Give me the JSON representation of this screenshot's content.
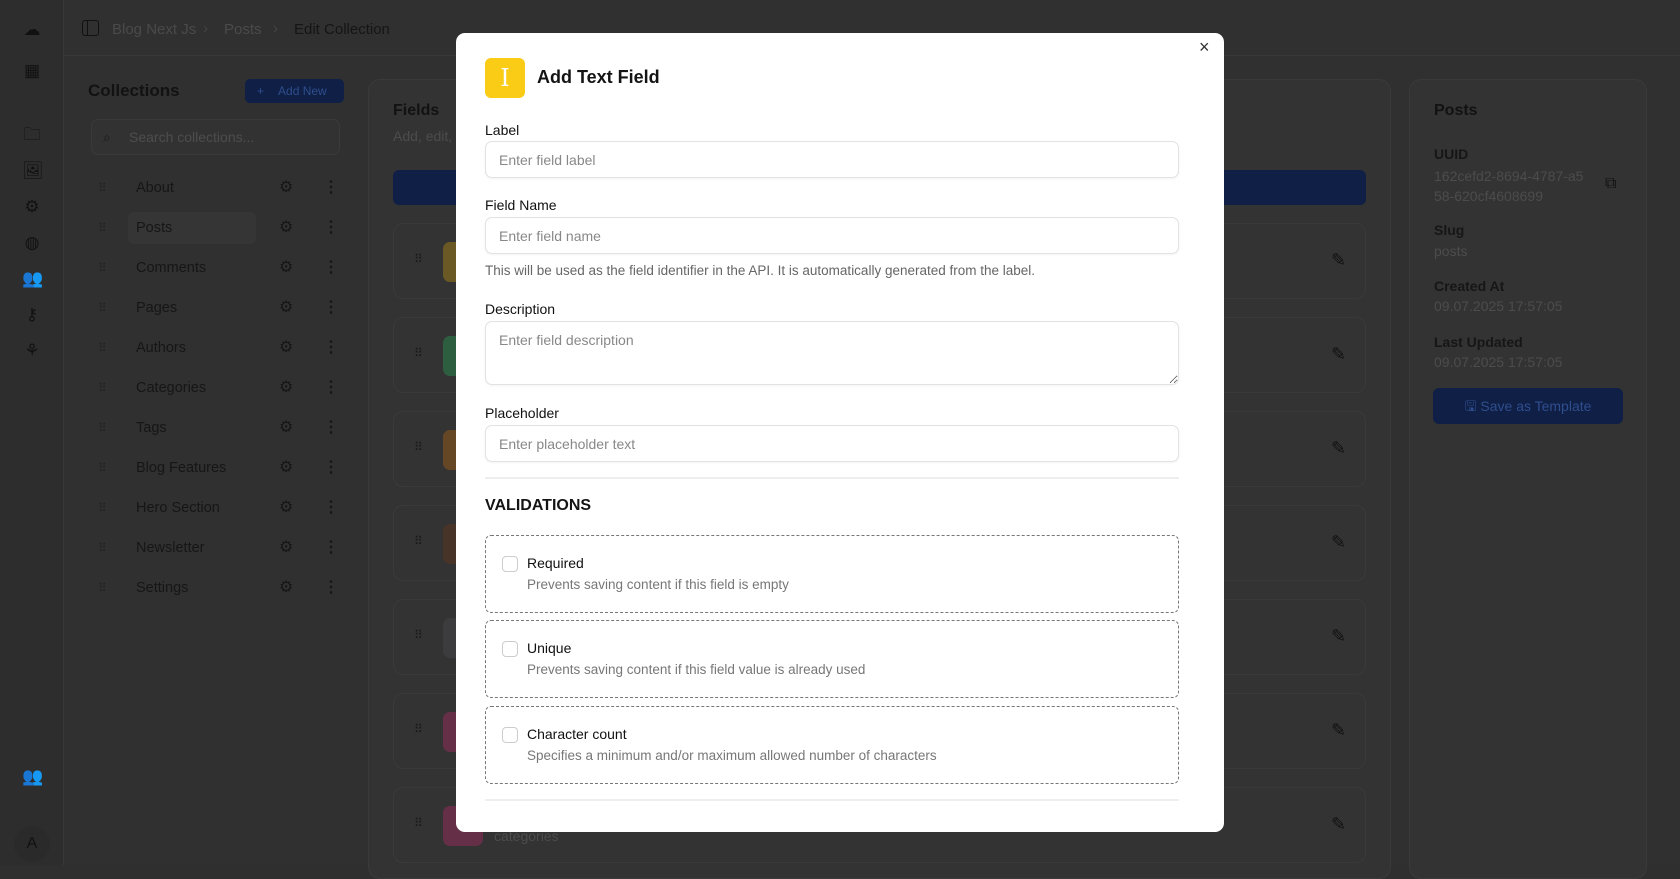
{
  "breadcrumb": [
    "Blog Next Js",
    "Posts",
    "Edit Collection"
  ],
  "collections": {
    "title": "Collections",
    "add_new": "Add New",
    "search_placeholder": "Search collections...",
    "items": [
      "About",
      "Posts",
      "Comments",
      "Pages",
      "Authors",
      "Categories",
      "Tags",
      "Blog Features",
      "Hero Section",
      "Newsletter",
      "Settings"
    ],
    "selected": "Posts"
  },
  "fields": {
    "title": "Fields",
    "subtitle": "Add, edit,",
    "last_field_slug": "categories",
    "icon_colors": [
      "#eab308",
      "#22c55e",
      "#d97706",
      "#78350f",
      "#52525b",
      "#db2777",
      "#db2777"
    ]
  },
  "info": {
    "title": "Posts",
    "uuid_label": "UUID",
    "uuid": "162cefd2-8694-4787-a558-620cf4608699",
    "slug_label": "Slug",
    "slug": "posts",
    "created_label": "Created At",
    "created": "09.07.2025 17:57:05",
    "updated_label": "Last Updated",
    "updated": "09.07.2025 17:57:05",
    "save_template": "Save as Template"
  },
  "user_initial": "A",
  "modal": {
    "title": "Add Text Field",
    "icon_color": "#facc15",
    "label": {
      "label": "Label",
      "placeholder": "Enter field label"
    },
    "field_name": {
      "label": "Field Name",
      "placeholder": "Enter field name",
      "help": "This will be used as the field identifier in the API. It is automatically generated from the label."
    },
    "description": {
      "label": "Description",
      "placeholder": "Enter field description"
    },
    "placeholder": {
      "label": "Placeholder",
      "placeholder": "Enter placeholder text"
    },
    "validations_title": "VALIDATIONS",
    "validations": [
      {
        "title": "Required",
        "desc": "Prevents saving content if this field is empty",
        "checked": false
      },
      {
        "title": "Unique",
        "desc": "Prevents saving content if this field value is already used",
        "checked": false
      },
      {
        "title": "Character count",
        "desc": "Specifies a minimum and/or maximum allowed number of characters",
        "checked": false
      }
    ]
  }
}
